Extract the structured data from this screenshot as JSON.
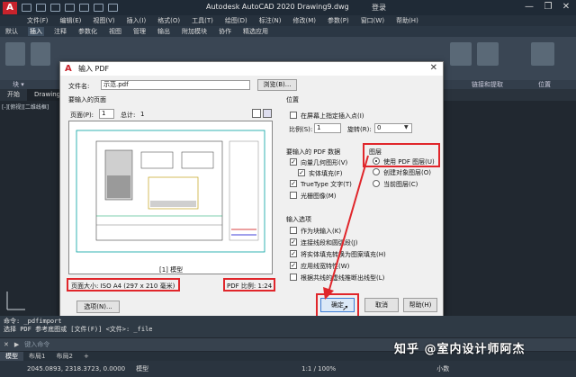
{
  "app": {
    "title": "Autodesk AutoCAD 2020    Drawing9.dwg",
    "login": "登录",
    "window_controls": [
      "—",
      "❐",
      "✕"
    ]
  },
  "menu": [
    "文件(F)",
    "编辑(E)",
    "视图(V)",
    "插入(I)",
    "格式(O)",
    "工具(T)",
    "绘图(D)",
    "标注(N)",
    "修改(M)",
    "参数(P)",
    "窗口(W)",
    "帮助(H)"
  ],
  "ribbon_tabs": [
    "默认",
    "插入",
    "注释",
    "参数化",
    "视图",
    "管理",
    "输出",
    "附加模块",
    "协作",
    "精选应用"
  ],
  "ribbon_active_tab": "插入",
  "panel_labels": {
    "left": "块 ▾",
    "right1": "链接和提取",
    "right2": "位置"
  },
  "doc_tabs": [
    "开始",
    "Drawing9*"
  ],
  "viewport_label": "[-][俯视][二维线框]",
  "dialog": {
    "title": "输入 PDF",
    "file_label": "文件名:",
    "file_value": "示范.pdf",
    "browse_button": "浏览(B)...",
    "pages_label": "要输入的页面",
    "page_label": "页面(P):",
    "page_value": "1",
    "total_label": "总计:",
    "total_value": "1",
    "preview_caption": "[1] 模型",
    "page_size": "页面大小: ISO A4 (297 x 210 毫米)",
    "pdf_scale": "PDF 比例: 1:24",
    "options_button": "选项(N)...",
    "position_group": "位置",
    "specify_on_screen": "在屏幕上指定插入点(I)",
    "scale_label": "比例(S):",
    "scale_value": "1",
    "rotation_label": "旋转(R):",
    "rotation_value": "0",
    "pdf_data_group": "要输入的 PDF 数据",
    "data_items": [
      {
        "label": "向量几何图形(V)",
        "checked": true
      },
      {
        "label": "实体填充(F)",
        "checked": true
      },
      {
        "label": "TrueType 文字(T)",
        "checked": true
      },
      {
        "label": "光栅图像(M)",
        "checked": false
      }
    ],
    "layers_group": "图层",
    "layer_options": [
      {
        "label": "使用 PDF 图层(U)",
        "selected": true
      },
      {
        "label": "创建对象图层(O)",
        "selected": false
      },
      {
        "label": "当前图层(C)",
        "selected": false
      }
    ],
    "import_group": "输入选项",
    "import_items": [
      {
        "label": "作为块输入(K)",
        "checked": false
      },
      {
        "label": "连接线段和圆弧段(J)",
        "checked": true
      },
      {
        "label": "将实体填充转换为图案填充(H)",
        "checked": true
      },
      {
        "label": "应用线宽特性(W)",
        "checked": true
      },
      {
        "label": "根据共线的虚线推断出线型(L)",
        "checked": false
      }
    ],
    "ok_button": "确定",
    "cancel_button": "取消",
    "help_button": "帮助(H)"
  },
  "command_history": [
    "命令: _pdfimport",
    "选择 PDF 参考底图或 [文件(F)] <文件>: _file"
  ],
  "command_placeholder": "键入命令",
  "layout_tabs": [
    "模型",
    "布局1",
    "布局2",
    "+"
  ],
  "status": {
    "coords": "2045.0893, 2318.3723, 0.0000",
    "model": "模型",
    "scale": "1:1 / 100%",
    "units": "小数"
  },
  "watermark": "知乎 @室内设计师阿杰",
  "colors": {
    "highlight_red": "#e0262b",
    "arrow_red": "#e0262b",
    "autocad_red": "#c8232c"
  }
}
